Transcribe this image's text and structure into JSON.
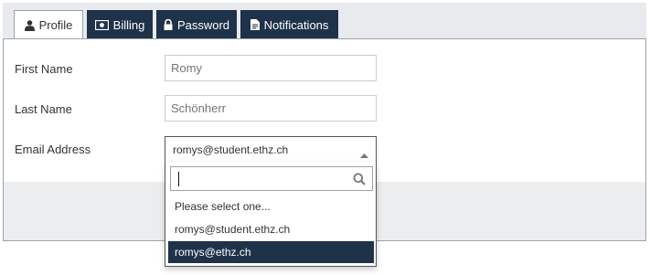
{
  "tabs": [
    {
      "label": "Profile",
      "icon": "user-icon",
      "active": true
    },
    {
      "label": "Billing",
      "icon": "money-icon",
      "active": false
    },
    {
      "label": "Password",
      "icon": "lock-icon",
      "active": false
    },
    {
      "label": "Notifications",
      "icon": "document-icon",
      "active": false
    }
  ],
  "form": {
    "first_name": {
      "label": "First Name",
      "placeholder": "Romy"
    },
    "last_name": {
      "label": "Last Name",
      "placeholder": "Schönherr"
    },
    "email": {
      "label": "Email Address",
      "selected": "romys@student.ethz.ch",
      "search_value": "",
      "options": [
        "Please select one...",
        "romys@student.ethz.ch",
        "romys@ethz.ch"
      ],
      "highlighted": "romys@ethz.ch"
    }
  },
  "colors": {
    "accent": "#1e3249",
    "tabbar_bg": "#e8eaed",
    "footer_bg": "#ecedef"
  }
}
